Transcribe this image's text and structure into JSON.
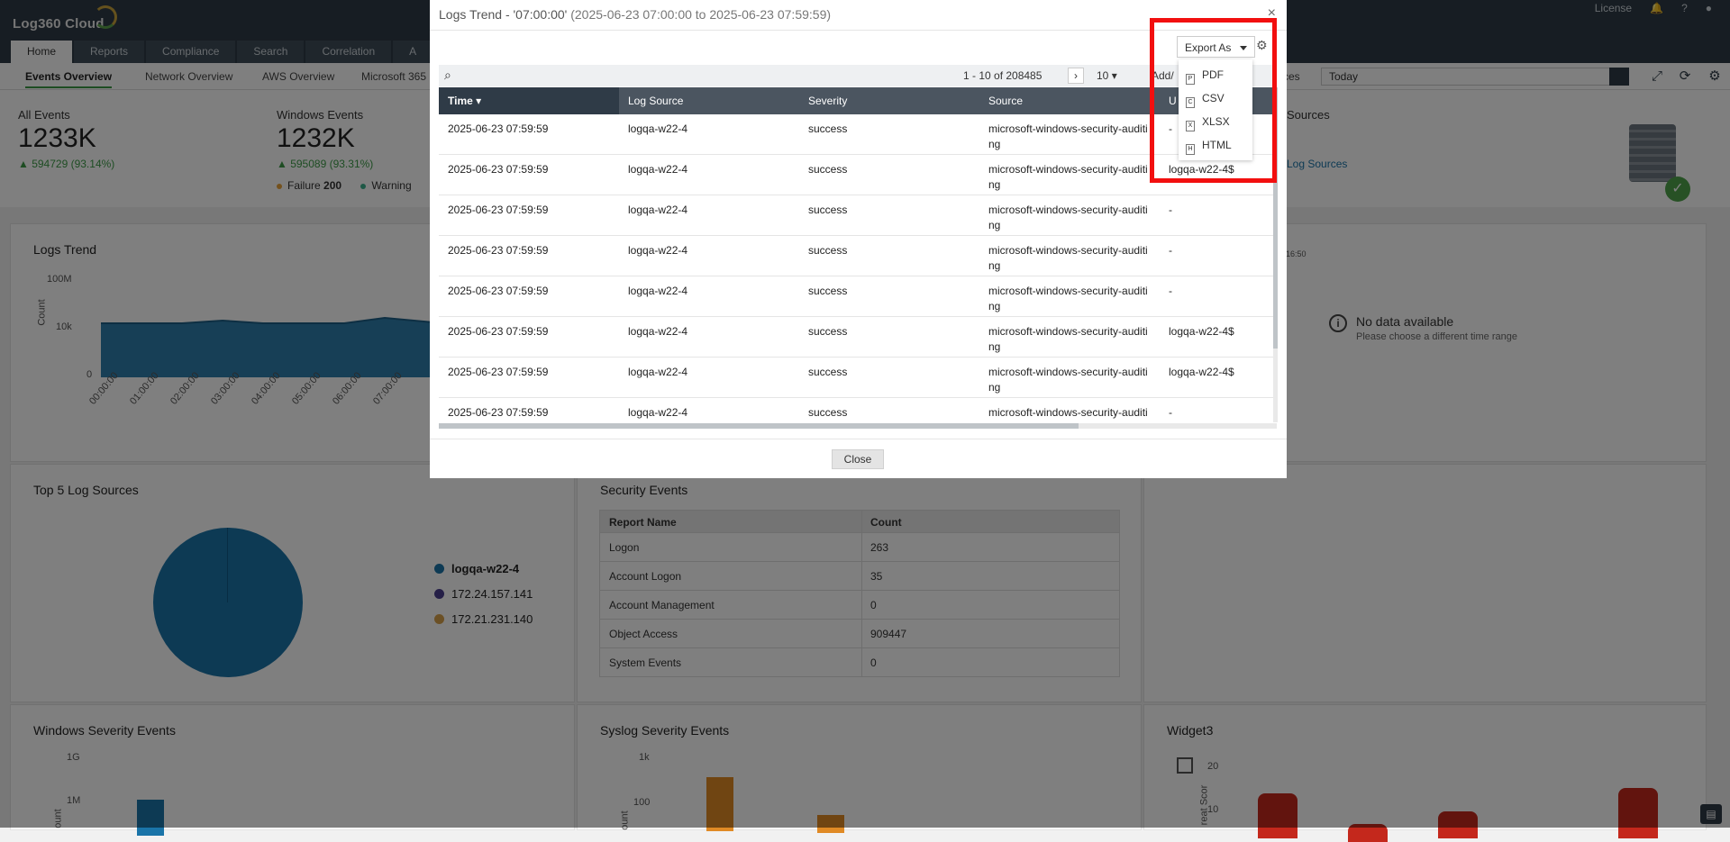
{
  "app": {
    "logo": "Log360 Cloud",
    "tabs": [
      "Home",
      "Reports",
      "Compliance",
      "Search",
      "Correlation",
      "A"
    ],
    "top_right": {
      "license": "License",
      "help": "?"
    }
  },
  "subnav": {
    "items": [
      "Events Overview",
      "Network Overview",
      "AWS Overview",
      "Microsoft 365",
      "ces"
    ],
    "date_range": "Today"
  },
  "stats": {
    "all_events": {
      "label": "All Events",
      "value": "1233K",
      "change": "▲ 594729 (93.14%)"
    },
    "windows_events": {
      "label": "Windows Events",
      "value": "1232K",
      "change": "▲ 595089 (93.31%)",
      "failure_label": "Failure",
      "failure_value": "200",
      "warning_label": "Warning"
    },
    "sources": {
      "label": "Sources",
      "link": "Log Sources"
    }
  },
  "widgets": {
    "logs_trend": {
      "title": "Logs Trend",
      "ylabel": "Count",
      "yticks": [
        "100M",
        "10k",
        "0"
      ],
      "xticks": [
        "00:00:00",
        "01:00:00",
        "02:00:00",
        "03:00:00",
        "04:00:00",
        "05:00:00",
        "06:00:00",
        "07:00:00"
      ]
    },
    "right_panel": {
      "time": "16:50",
      "nodata": "No data available",
      "nodata_sub": "Please choose a different time range"
    },
    "top5": {
      "title": "Top 5 Log Sources",
      "legend": [
        "logqa-w22-4",
        "172.24.157.141",
        "172.21.231.140"
      ],
      "colors": [
        "#1a74a8",
        "#4a3f8f",
        "#d7a04a"
      ]
    },
    "security": {
      "title": "Security Events",
      "headers": [
        "Report Name",
        "Count"
      ],
      "rows": [
        [
          "Logon",
          "263"
        ],
        [
          "Account Logon",
          "35"
        ],
        [
          "Account Management",
          "0"
        ],
        [
          "Object Access",
          "909447"
        ],
        [
          "System Events",
          "0"
        ]
      ]
    },
    "windows_severity": {
      "title": "Windows Severity Events",
      "yticks": [
        "1G",
        "1M"
      ],
      "ylabel": "ount"
    },
    "syslog_severity": {
      "title": "Syslog Severity Events",
      "yticks": [
        "1k",
        "100"
      ],
      "ylabel": "ount"
    },
    "widget3": {
      "title": "Widget3",
      "yticks": [
        "20",
        "10"
      ],
      "ylabel": "reat Scor"
    }
  },
  "modal": {
    "title": "Logs Trend - '07:00:00'",
    "subtitle": "(2025-06-23 07:00:00 to 2025-06-23 07:59:59)",
    "close_x": "×",
    "export_label": "Export As",
    "export_options": [
      "PDF",
      "CSV",
      "XLSX",
      "HTML"
    ],
    "pager": "1 - 10 of 208485",
    "page_size": "10",
    "add_columns": "Add/",
    "add_columns_tail": "ns",
    "columns": [
      "Time",
      "Log Source",
      "Severity",
      "Source",
      "U"
    ],
    "rows": [
      [
        "2025-06-23 07:59:59",
        "logqa-w22-4",
        "success",
        "microsoft-windows-security-auditing",
        "-"
      ],
      [
        "2025-06-23 07:59:59",
        "logqa-w22-4",
        "success",
        "microsoft-windows-security-auditing",
        "logqa-w22-4$"
      ],
      [
        "2025-06-23 07:59:59",
        "logqa-w22-4",
        "success",
        "microsoft-windows-security-auditing",
        "-"
      ],
      [
        "2025-06-23 07:59:59",
        "logqa-w22-4",
        "success",
        "microsoft-windows-security-auditing",
        "-"
      ],
      [
        "2025-06-23 07:59:59",
        "logqa-w22-4",
        "success",
        "microsoft-windows-security-auditing",
        "-"
      ],
      [
        "2025-06-23 07:59:59",
        "logqa-w22-4",
        "success",
        "microsoft-windows-security-auditing",
        "logqa-w22-4$"
      ],
      [
        "2025-06-23 07:59:59",
        "logqa-w22-4",
        "success",
        "microsoft-windows-security-auditing",
        "logqa-w22-4$"
      ],
      [
        "2025-06-23 07:59:59",
        "logqa-w22-4",
        "success",
        "microsoft-windows-security-auditing",
        "-"
      ]
    ],
    "close_label": "Close"
  }
}
